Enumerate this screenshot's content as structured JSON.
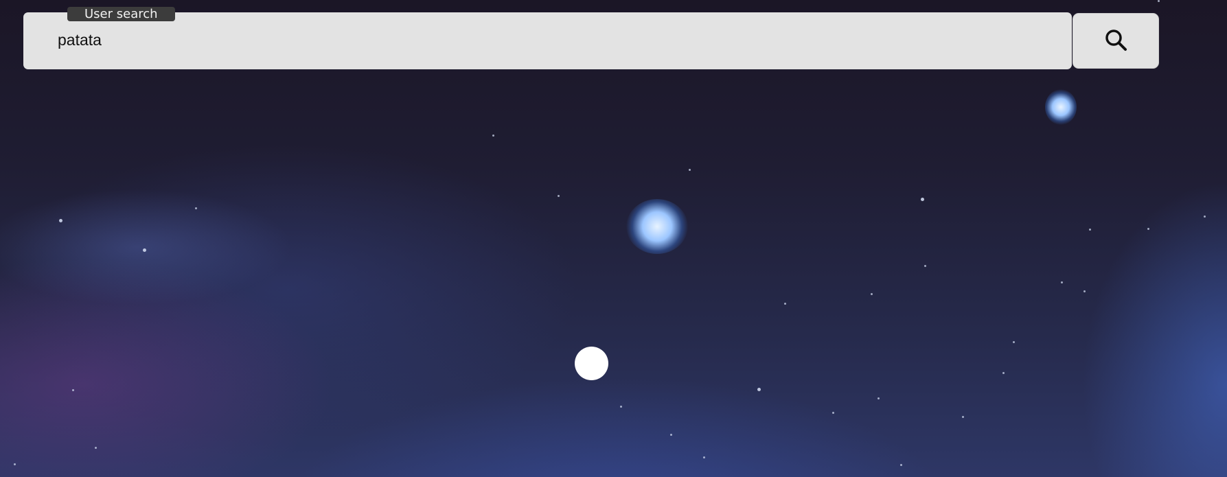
{
  "search": {
    "label": "User search",
    "value": "patata",
    "field_background": "#e3e3e3",
    "label_background": "#3c3c3c"
  },
  "search_button": {
    "icon": "search-icon"
  },
  "desktop": {
    "background": "night-sky-wallpaper"
  }
}
